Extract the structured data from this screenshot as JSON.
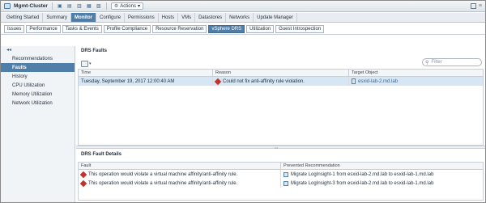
{
  "titlebar": {
    "title": "Mgmt-Cluster",
    "actions_label": "Actions"
  },
  "main_tabs": [
    "Getting Started",
    "Summary",
    "Monitor",
    "Configure",
    "Permissions",
    "Hosts",
    "VMs",
    "Datastores",
    "Networks",
    "Update Manager"
  ],
  "main_active": "Monitor",
  "sub_tabs": [
    "Issues",
    "Performance",
    "Tasks & Events",
    "Profile Compliance",
    "Resource Reservation",
    "vSphere DRS",
    "Utilization",
    "Guest Introspection"
  ],
  "sub_active": "vSphere DRS",
  "sidebar": {
    "items": [
      "Recommendations",
      "Faults",
      "History",
      "CPU Utilization",
      "Memory Utilization",
      "Network Utilization"
    ],
    "active": "Faults"
  },
  "drs_faults": {
    "title": "DRS Faults",
    "filter_placeholder": "Filter",
    "columns": [
      "Time",
      "Reason",
      "Target Object"
    ],
    "rows": [
      {
        "time": "Tuesday, September 19, 2017 12:00:40 AM",
        "reason": "Could not fix anti-affinity rule violation.",
        "target": "esxid-lab-2.md.lab"
      }
    ]
  },
  "fault_details": {
    "title": "DRS Fault Details",
    "columns": [
      "Fault",
      "Prevented Recommendation"
    ],
    "rows": [
      {
        "fault": "This operation would violate a virtual machine affinity/anti-affinity rule.",
        "recommendation": "Migrate LogInsight-1 from esxid-lab-2.md.lab to esxid-lab-1.md.lab"
      },
      {
        "fault": "This operation would violate a virtual machine affinity/anti-affinity rule.",
        "recommendation": "Migrate LogInsight-3 from esxid-lab-2.md.lab to esxid-lab-1.md.lab"
      }
    ]
  },
  "colors": {
    "accent": "#4f7fa8",
    "error": "#c2342b",
    "selected_row": "#d6e6f4"
  }
}
